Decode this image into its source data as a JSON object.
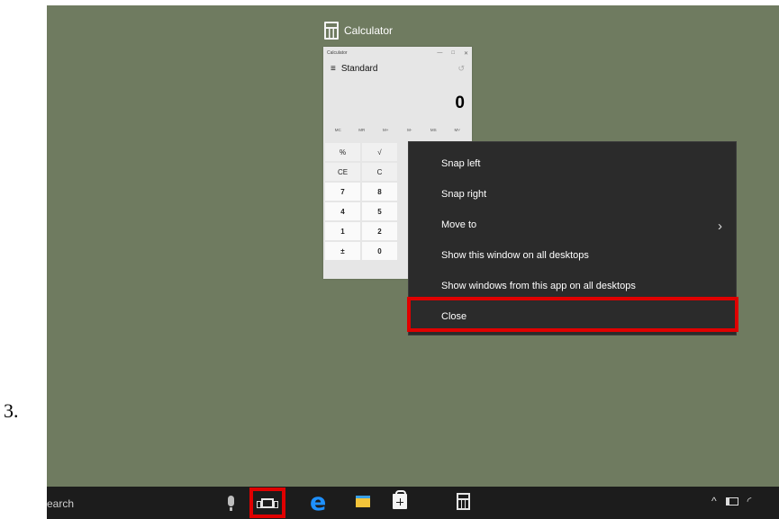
{
  "step_number": "3.",
  "task_view": {
    "window_title": "Calculator",
    "window_icon": "calculator-icon"
  },
  "calculator_thumbnail": {
    "titlebar_text": "Calculator",
    "controls": [
      "—",
      "□",
      "✕"
    ],
    "mode": "Standard",
    "display": "0",
    "memory_buttons": [
      "MC",
      "MR",
      "M+",
      "M-",
      "MS",
      "M˅"
    ],
    "keys": [
      [
        "%",
        "√"
      ],
      [
        "CE",
        "C"
      ],
      [
        "7",
        "8"
      ],
      [
        "4",
        "5"
      ],
      [
        "1",
        "2"
      ],
      [
        "±",
        "0"
      ]
    ]
  },
  "context_menu": {
    "items": [
      {
        "label": "Snap left",
        "submenu": false
      },
      {
        "label": "Snap right",
        "submenu": false
      },
      {
        "label": "Move to",
        "submenu": true
      },
      {
        "label": "Show this window on all desktops",
        "submenu": false
      },
      {
        "label": "Show windows from this app on all desktops",
        "submenu": false
      },
      {
        "label": "Close",
        "submenu": false,
        "highlighted": true
      }
    ],
    "highlight_color": "#e00000"
  },
  "taskbar": {
    "search_text": "earch",
    "icons": [
      "microphone-icon",
      "task-view-icon",
      "edge-icon",
      "file-explorer-icon",
      "store-icon",
      "calculator-icon"
    ],
    "tray_icons": [
      "chevron-up-icon",
      "network-icon",
      "wifi-icon"
    ]
  },
  "colors": {
    "desktop": "#6f7b60",
    "taskbar": "#1c1c1c",
    "menu": "#2b2b2b",
    "highlight": "#e00000"
  }
}
